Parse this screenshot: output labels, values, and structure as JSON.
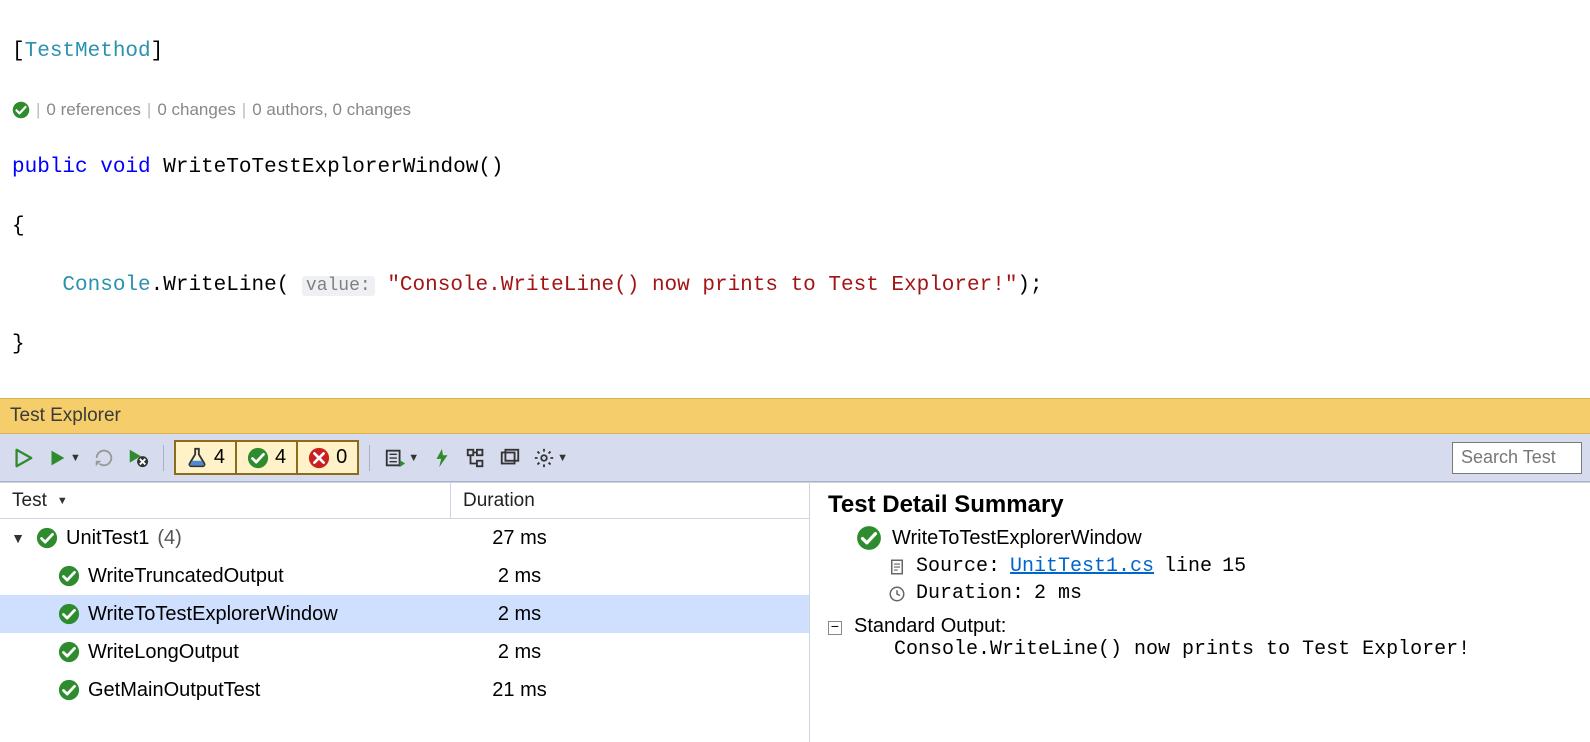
{
  "code": {
    "attribute_open": "[",
    "attribute_name": "TestMethod",
    "attribute_close": "]",
    "codelens": {
      "refs": "0 references",
      "changes": "0 changes",
      "authors": "0 authors, 0 changes"
    },
    "sig_kw1": "public",
    "sig_kw2": "void",
    "sig_name": "WriteToTestExplorerWindow",
    "sig_parens": "()",
    "brace_open": "{",
    "call_type": "Console",
    "call_dot": ".",
    "call_method": "WriteLine",
    "call_open": "(",
    "param_hint": "value:",
    "string_literal": "\"Console.WriteLine() now prints to Test Explorer!\"",
    "call_close": ");",
    "brace_close": "}"
  },
  "panel": {
    "title": "Test Explorer",
    "search_placeholder": "Search Test"
  },
  "counters": {
    "total": "4",
    "passed": "4",
    "failed": "0"
  },
  "columns": {
    "test": "Test",
    "duration": "Duration"
  },
  "tree": {
    "group": {
      "name": "UnitTest1",
      "count": "(4)",
      "duration": "27 ms"
    },
    "items": [
      {
        "name": "WriteTruncatedOutput",
        "duration": "2 ms"
      },
      {
        "name": "WriteToTestExplorerWindow",
        "duration": "2 ms"
      },
      {
        "name": "WriteLongOutput",
        "duration": "2 ms"
      },
      {
        "name": "GetMainOutputTest",
        "duration": "21 ms"
      }
    ],
    "selected_index": 1
  },
  "detail": {
    "heading": "Test Detail Summary",
    "test_name": "WriteToTestExplorerWindow",
    "source_label": "Source:",
    "source_file": "UnitTest1.cs",
    "source_line_prefix": "line",
    "source_line": "15",
    "duration_label": "Duration:",
    "duration_value": "2 ms",
    "output_label": "Standard Output:",
    "output_value": "Console.WriteLine() now prints to Test Explorer!"
  }
}
